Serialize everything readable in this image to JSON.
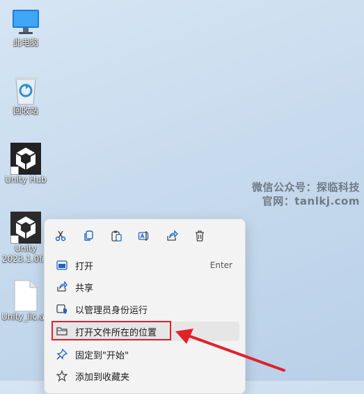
{
  "desktop": {
    "icons": [
      {
        "label": "此电脑",
        "icon": "monitor-icon"
      },
      {
        "label": "回收站",
        "icon": "recycle-bin-icon"
      },
      {
        "label": "Unity Hub",
        "icon": "unity-icon"
      },
      {
        "label": "Unity",
        "label2": "2023.1.0f...",
        "icon": "unity-icon"
      },
      {
        "label": "Unity_lic.al...",
        "icon": "file-icon"
      }
    ]
  },
  "watermark": {
    "line1": "微信公众号：探临科技",
    "line2": "官网：tanlkj.com"
  },
  "context_menu": {
    "toolbar": [
      {
        "name": "cut",
        "icon": "scissors-icon"
      },
      {
        "name": "copy",
        "icon": "copy-icon"
      },
      {
        "name": "paste",
        "icon": "paste-icon"
      },
      {
        "name": "rename",
        "icon": "rename-icon"
      },
      {
        "name": "share",
        "icon": "share-icon"
      },
      {
        "name": "delete",
        "icon": "trash-icon"
      }
    ],
    "items": [
      {
        "label": "打开",
        "shortcut": "Enter",
        "icon": "open-icon"
      },
      {
        "label": "共享",
        "shortcut": "",
        "icon": "share-icon"
      },
      {
        "label": "以管理员身份运行",
        "shortcut": "",
        "icon": "shield-icon"
      },
      {
        "label": "打开文件所在的位置",
        "shortcut": "",
        "icon": "folder-icon",
        "highlighted": true
      },
      {
        "label": "固定到\"开始\"",
        "shortcut": "",
        "icon": "pin-icon"
      },
      {
        "label": "添加到收藏夹",
        "shortcut": "",
        "icon": "star-icon"
      }
    ]
  },
  "colors": {
    "annotation_red": "#e0212a",
    "accent_blue": "#1e63c6"
  }
}
